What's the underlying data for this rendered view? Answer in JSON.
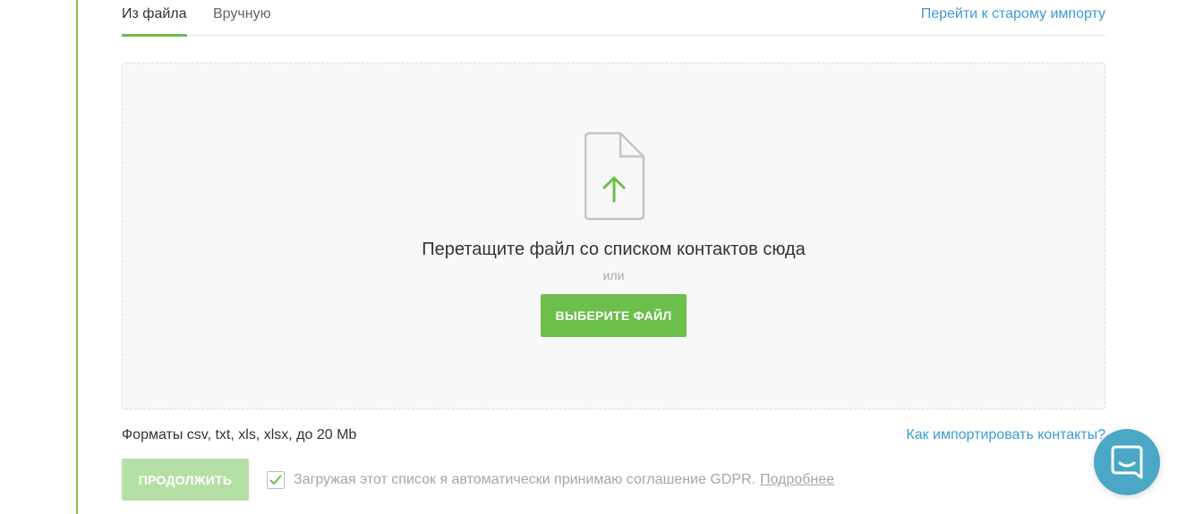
{
  "tabs": {
    "from_file": "Из файла",
    "manual": "Вручную",
    "old_import": "Перейти к старому импорту"
  },
  "dropzone": {
    "title": "Перетащите файл со списком контактов сюда",
    "or": "или",
    "choose_button": "ВЫБЕРИТЕ ФАЙЛ",
    "icon": "file-upload-icon"
  },
  "footer": {
    "formats": "Форматы csv, txt, xls, xlsx, до 20 Mb",
    "how_to_import": "Как импортировать контакты?",
    "continue_button": "ПРОДОЛЖИТЬ",
    "gdpr_checked": true,
    "gdpr_text": "Загружая этот список я автоматически принимаю соглашение GDPR.",
    "gdpr_link": "Подробнее"
  },
  "colors": {
    "accent_green": "#6cbf4b",
    "disabled_green": "#b5e0a5",
    "link_blue": "#3d9bd6",
    "chat_blue": "#4aa8c6"
  },
  "chat": {
    "icon": "chat-icon"
  }
}
